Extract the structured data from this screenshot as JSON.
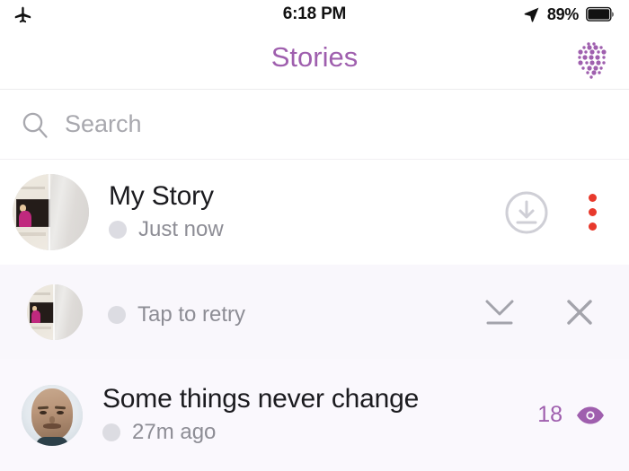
{
  "status_bar": {
    "airplane_icon": "airplane-mode-icon",
    "time": "6:18 PM",
    "location_icon": "location-arrow-icon",
    "battery_percent": "89%",
    "battery_icon": "battery-full-icon"
  },
  "header": {
    "title": "Stories",
    "title_color": "#9f5fae",
    "snapcode_icon": "snapcode-dots-icon"
  },
  "search": {
    "icon": "search-icon",
    "placeholder": "Search",
    "value": ""
  },
  "stories": [
    {
      "id": "my-story",
      "title": "My Story",
      "subtitle": "Just now",
      "avatar": "room-monitor-photo",
      "status_dot_color": "#dcdce2",
      "actions": [
        {
          "name": "download-circle-icon",
          "label": ""
        },
        {
          "name": "more-options-kebab-icon",
          "label": "",
          "color": "#e8392c"
        }
      ]
    },
    {
      "id": "failed-snap",
      "title": "",
      "subtitle": "Tap to retry",
      "avatar": "room-monitor-photo",
      "status_dot_color": "#dcdce2",
      "background": "#f9f7fc",
      "actions": [
        {
          "name": "download-icon",
          "label": ""
        },
        {
          "name": "close-icon",
          "label": ""
        }
      ]
    },
    {
      "id": "friend-story",
      "title": "Some things never change",
      "subtitle": "27m ago",
      "avatar": "man-face-photo",
      "status_dot_color": "#dcdce2",
      "background": "#faf8fd",
      "views": {
        "count": "18",
        "icon": "eye-icon",
        "color": "#9f5fae"
      }
    }
  ]
}
